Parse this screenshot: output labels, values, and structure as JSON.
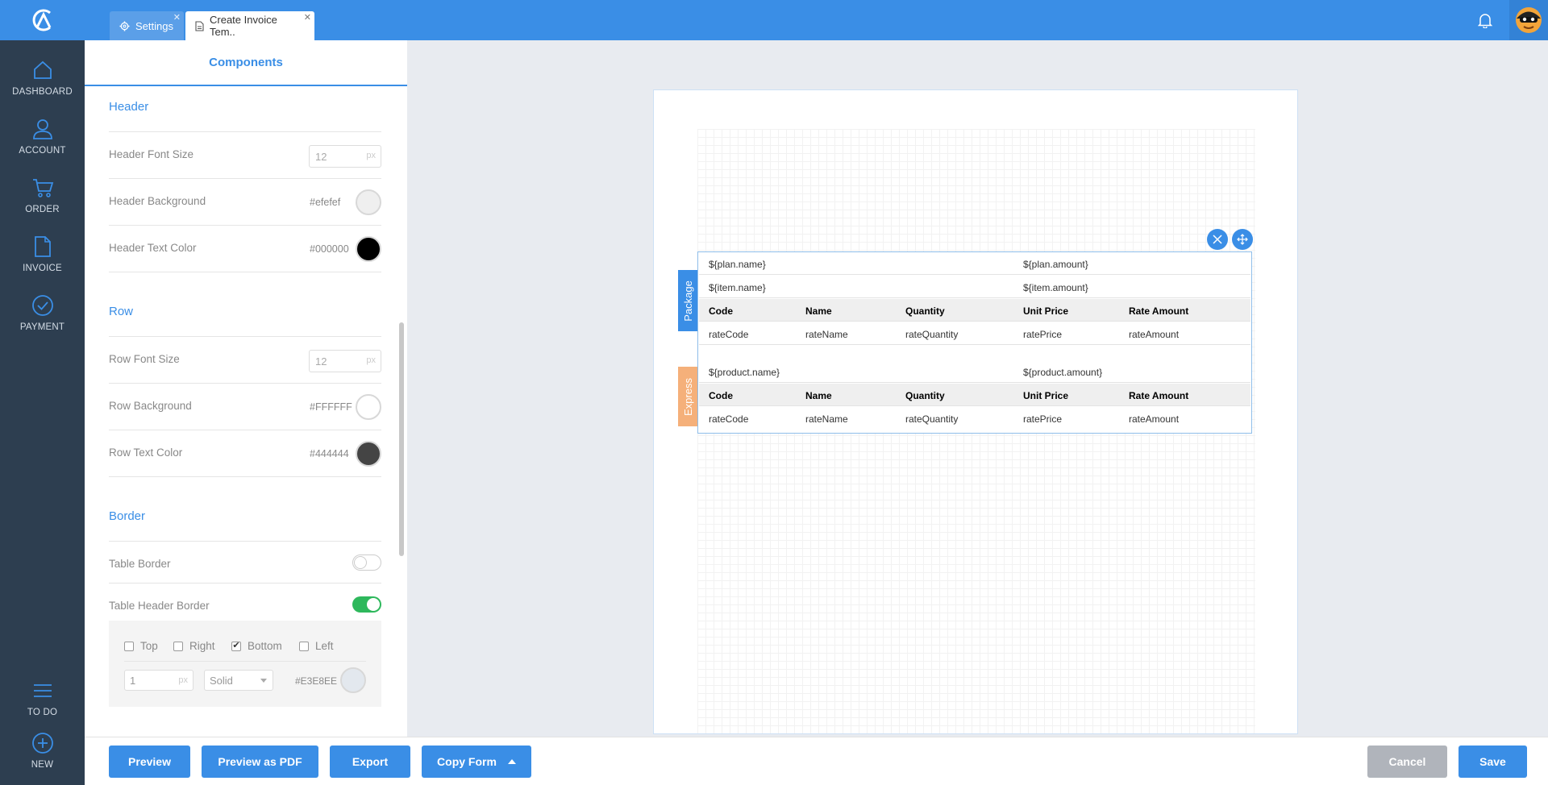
{
  "tabs": {
    "settings": "Settings",
    "active": "Create Invoice Tem.."
  },
  "nav": {
    "dashboard": "DASHBOARD",
    "account": "ACCOUNT",
    "order": "ORDER",
    "invoice": "INVOICE",
    "payment": "PAYMENT",
    "todo": "TO DO",
    "new": "NEW"
  },
  "panel": {
    "title": "Components",
    "header": {
      "title": "Header",
      "font_size_label": "Header Font Size",
      "font_size": "12",
      "background_label": "Header Background",
      "background": "#efefef",
      "text_color_label": "Header Text Color",
      "text_color": "#000000"
    },
    "row": {
      "title": "Row",
      "font_size_label": "Row Font Size",
      "font_size": "12",
      "background_label": "Row Background",
      "background": "#FFFFFF",
      "text_color_label": "Row Text Color",
      "text_color": "#444444"
    },
    "border": {
      "title": "Border",
      "table_border_label": "Table Border",
      "table_border_on": false,
      "table_header_border_label": "Table Header Border",
      "table_header_border_on": true,
      "top": "Top",
      "right": "Right",
      "bottom": "Bottom",
      "left": "Left",
      "width": "1",
      "style": "Solid",
      "color": "#E3E8EE"
    },
    "unit": "px"
  },
  "template": {
    "package_label": "Package",
    "express_label": "Express",
    "plan_name": "${plan.name}",
    "plan_amount": "${plan.amount}",
    "item_name": "${item.name}",
    "item_amount": "${item.amount}",
    "product_name": "${product.name}",
    "product_amount": "${product.amount}",
    "columns": [
      "Code",
      "Name",
      "Quantity",
      "Unit Price",
      "Rate Amount"
    ],
    "row_values": [
      "rateCode",
      "rateName",
      "rateQuantity",
      "ratePrice",
      "rateAmount"
    ]
  },
  "buttons": {
    "preview": "Preview",
    "preview_pdf": "Preview as PDF",
    "export": "Export",
    "copy_form": "Copy Form",
    "cancel": "Cancel",
    "save": "Save"
  },
  "colors": {
    "primary": "#3a8ee6",
    "nav_bg": "#2d3e50",
    "package_tag": "#3a8ee6",
    "express_tag": "#f5b07a",
    "toggle_on": "#2eb85c"
  }
}
